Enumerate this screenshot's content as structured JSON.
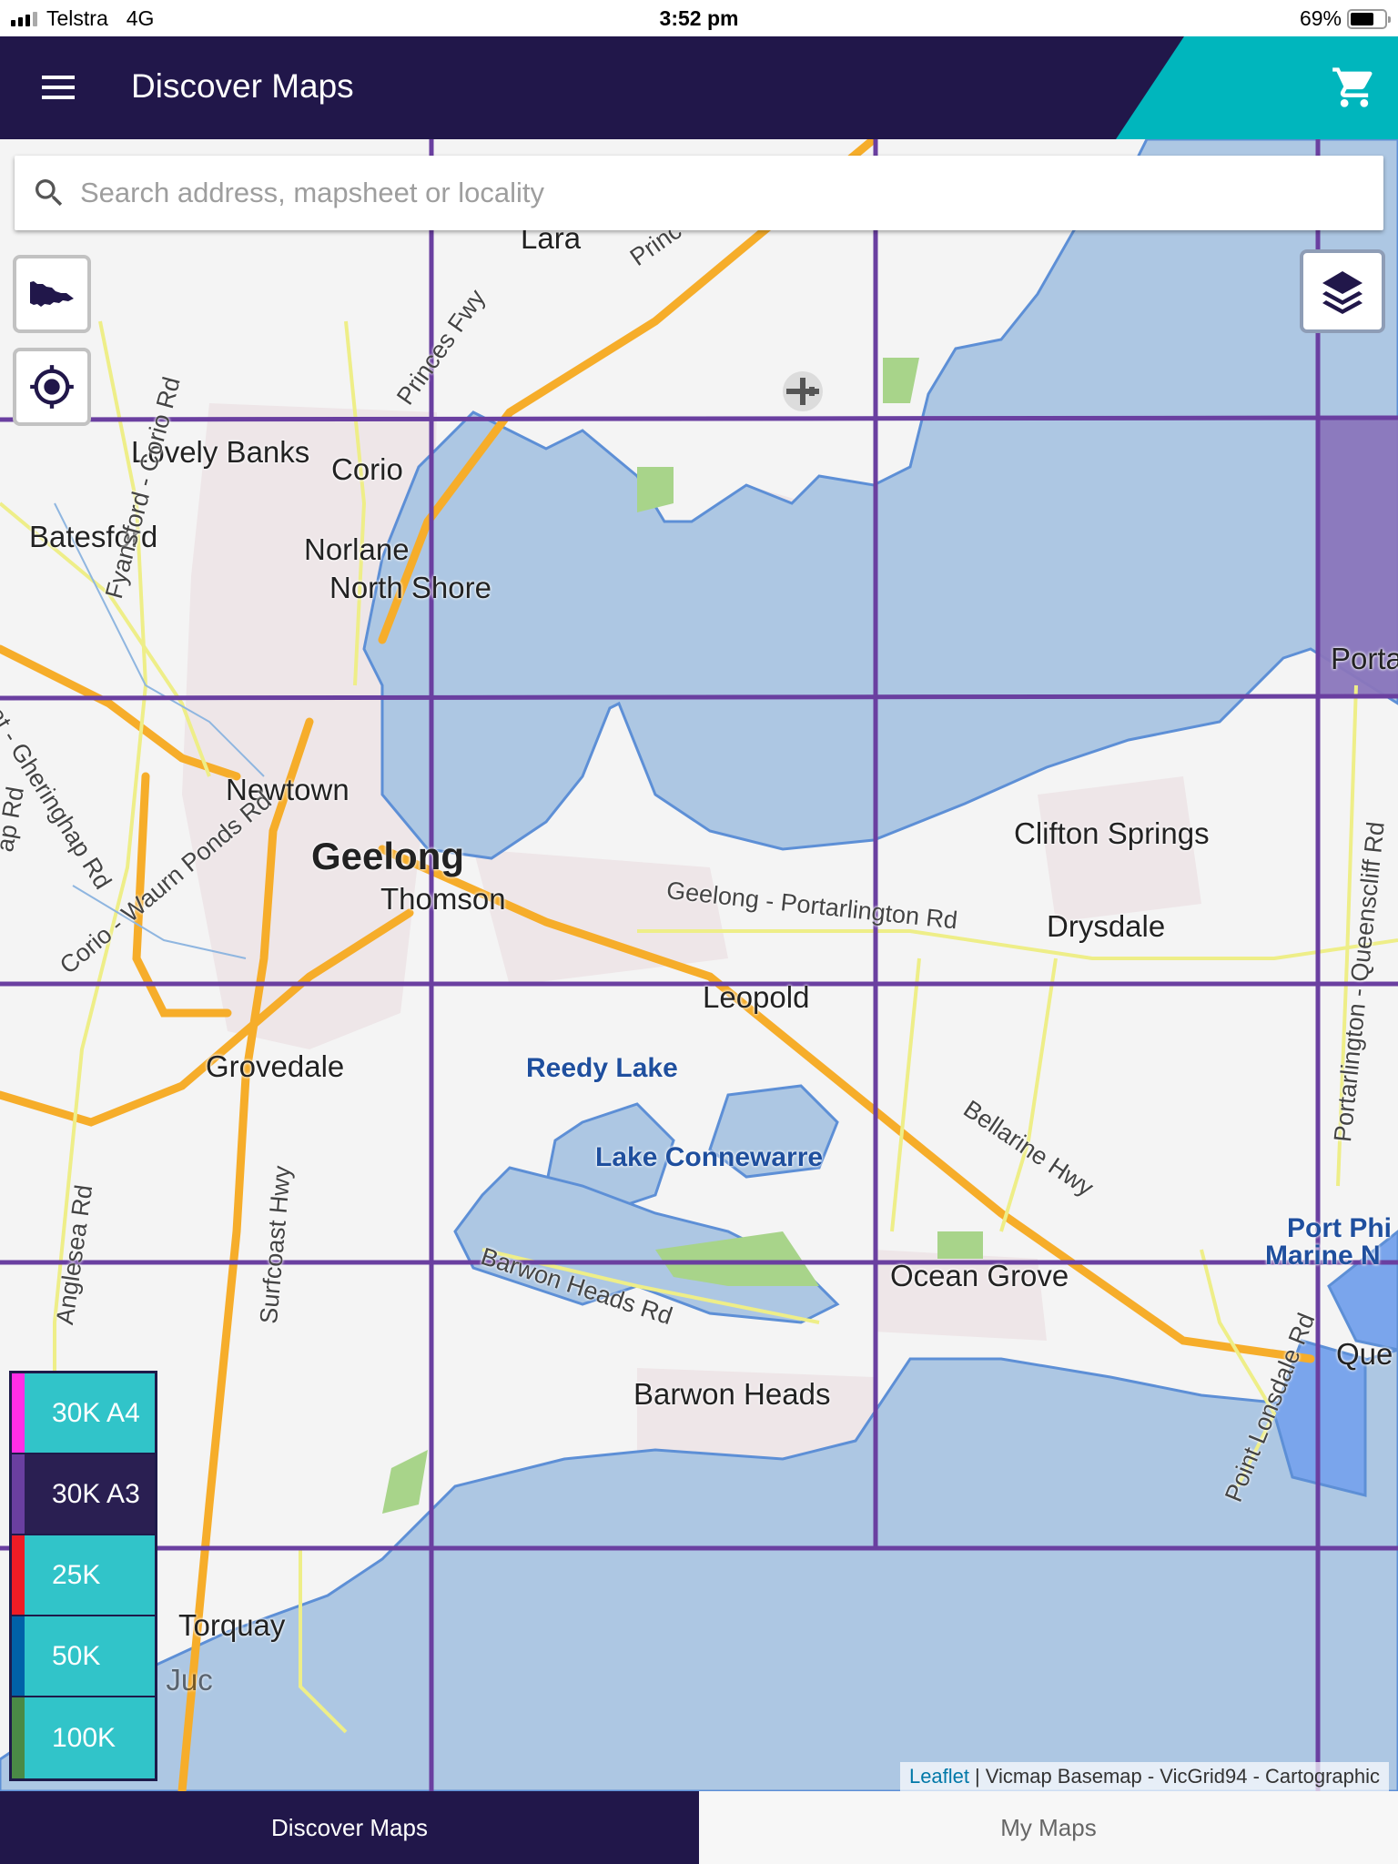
{
  "status_bar": {
    "carrier": "Telstra",
    "network": "4G",
    "time": "3:52 pm",
    "battery_percent": "69%",
    "battery_level": 0.69
  },
  "header": {
    "title": "Discover Maps",
    "menu_icon": "hamburger-menu-icon",
    "cart_icon": "shopping-cart-icon",
    "colors": {
      "primary": "#21174a",
      "accent": "#00b6bd"
    }
  },
  "search": {
    "placeholder": "Search address, mapsheet or locality",
    "value": "",
    "icon": "search-icon"
  },
  "map_controls": {
    "victoria_button_icon": "victoria-state-icon",
    "locate_button_icon": "locate-crosshair-icon",
    "layers_button_icon": "layers-icon"
  },
  "map_labels": {
    "localities": [
      {
        "name": "Lara"
      },
      {
        "name": "Lovely Banks"
      },
      {
        "name": "Corio"
      },
      {
        "name": "Batesford"
      },
      {
        "name": "Norlane"
      },
      {
        "name": "North Shore"
      },
      {
        "name": "Newtown"
      },
      {
        "name": "Geelong"
      },
      {
        "name": "Thomson"
      },
      {
        "name": "Leopold"
      },
      {
        "name": "Grovedale"
      },
      {
        "name": "Clifton Springs"
      },
      {
        "name": "Drysdale"
      },
      {
        "name": "Ocean Grove"
      },
      {
        "name": "Barwon Heads"
      },
      {
        "name": "Torquay"
      },
      {
        "name": "Jan Juc"
      },
      {
        "name": "Porta"
      },
      {
        "name": "Que"
      }
    ],
    "water": [
      {
        "name": "Reedy Lake"
      },
      {
        "name": "Lake Connewarre"
      },
      {
        "name": "Port Phi"
      },
      {
        "name": "Marine N"
      }
    ],
    "roads": [
      {
        "name": "Princes Fwy"
      },
      {
        "name": "Princ"
      },
      {
        "name": "Fyansford - Corio Rd"
      },
      {
        "name": "Ballarat - Gheringhap Rd"
      },
      {
        "name": "Corio - Waurn Ponds Rd"
      },
      {
        "name": "Surfcoast Hwy"
      },
      {
        "name": "Anglesea Rd"
      },
      {
        "name": "Geelong - Portarlington Rd"
      },
      {
        "name": "Bellarine Hwy"
      },
      {
        "name": "Barwon Heads Rd"
      },
      {
        "name": "Point Lonsdale Rd"
      },
      {
        "name": "Portarlington - Queenscliff Rd"
      },
      {
        "name": "ap Rd"
      }
    ]
  },
  "grid": {
    "line_color": "#6a3fa0",
    "highlight_color": "#8a76bc"
  },
  "legend": {
    "items": [
      {
        "label": "30K A4",
        "swatch": "#ff2ee6",
        "bg": "#31c4c9",
        "active": false
      },
      {
        "label": "30K A3",
        "swatch": "#6a3fa0",
        "bg": "#2a1f52",
        "active": true
      },
      {
        "label": "25K",
        "swatch": "#ee1c25",
        "bg": "#31c4c9",
        "active": false
      },
      {
        "label": "50K",
        "swatch": "#0061a8",
        "bg": "#31c4c9",
        "active": false
      },
      {
        "label": "100K",
        "swatch": "#4a8a46",
        "bg": "#31c4c9",
        "active": false
      }
    ]
  },
  "attribution": {
    "link": "Leaflet",
    "separator": "|",
    "text": "Vicmap Basemap - VicGrid94 - Cartographic"
  },
  "tabs": [
    {
      "label": "Discover Maps",
      "active": true
    },
    {
      "label": "My Maps",
      "active": false
    }
  ]
}
